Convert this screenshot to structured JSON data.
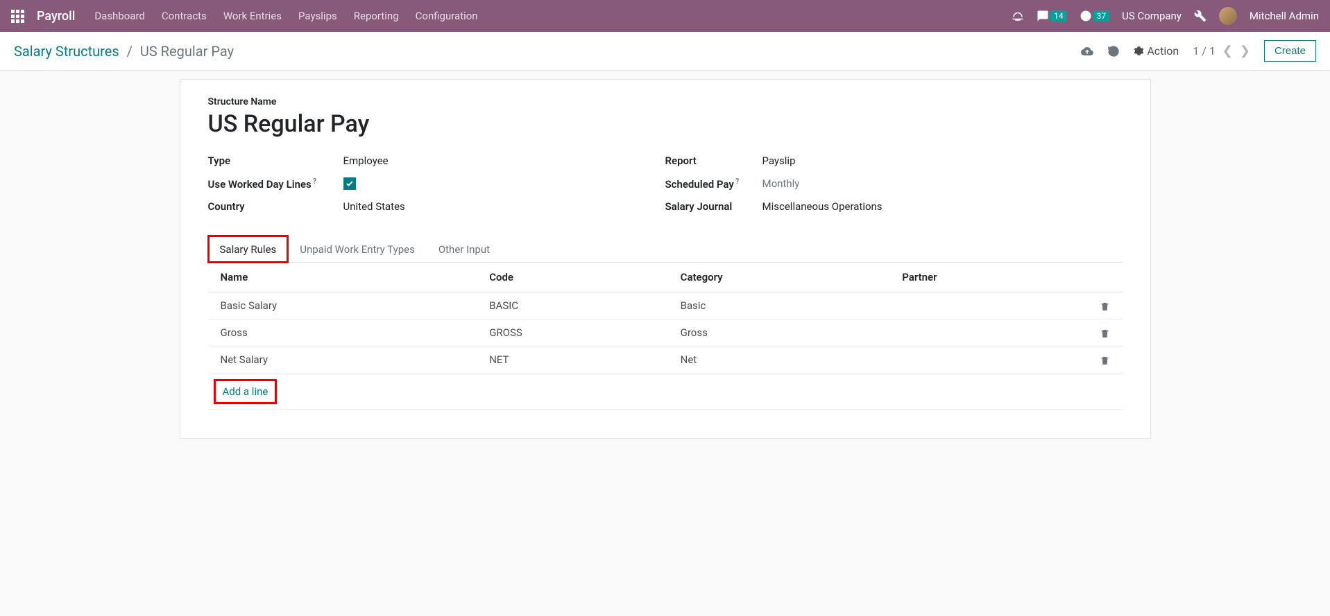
{
  "topbar": {
    "brand": "Payroll",
    "nav": [
      "Dashboard",
      "Contracts",
      "Work Entries",
      "Payslips",
      "Reporting",
      "Configuration"
    ],
    "messages_badge": "14",
    "activities_badge": "37",
    "company": "US Company",
    "user": "Mitchell Admin"
  },
  "controlbar": {
    "breadcrumb_root": "Salary Structures",
    "breadcrumb_current": "US Regular Pay",
    "action_label": "Action",
    "pager": "1 / 1",
    "create_label": "Create"
  },
  "form": {
    "structure_name_label": "Structure Name",
    "structure_name_value": "US Regular Pay",
    "left": {
      "type_label": "Type",
      "type_value": "Employee",
      "uwdl_label": "Use Worked Day Lines",
      "country_label": "Country",
      "country_value": "United States"
    },
    "right": {
      "report_label": "Report",
      "report_value": "Payslip",
      "sched_label": "Scheduled Pay",
      "sched_value": "Monthly",
      "journal_label": "Salary Journal",
      "journal_value": "Miscellaneous Operations"
    }
  },
  "tabs": [
    "Salary Rules",
    "Unpaid Work Entry Types",
    "Other Input"
  ],
  "table": {
    "headers": {
      "name": "Name",
      "code": "Code",
      "category": "Category",
      "partner": "Partner"
    },
    "rows": [
      {
        "name": "Basic Salary",
        "code": "BASIC",
        "category": "Basic",
        "partner": ""
      },
      {
        "name": "Gross",
        "code": "GROSS",
        "category": "Gross",
        "partner": ""
      },
      {
        "name": "Net Salary",
        "code": "NET",
        "category": "Net",
        "partner": ""
      }
    ],
    "add_line_label": "Add a line"
  }
}
